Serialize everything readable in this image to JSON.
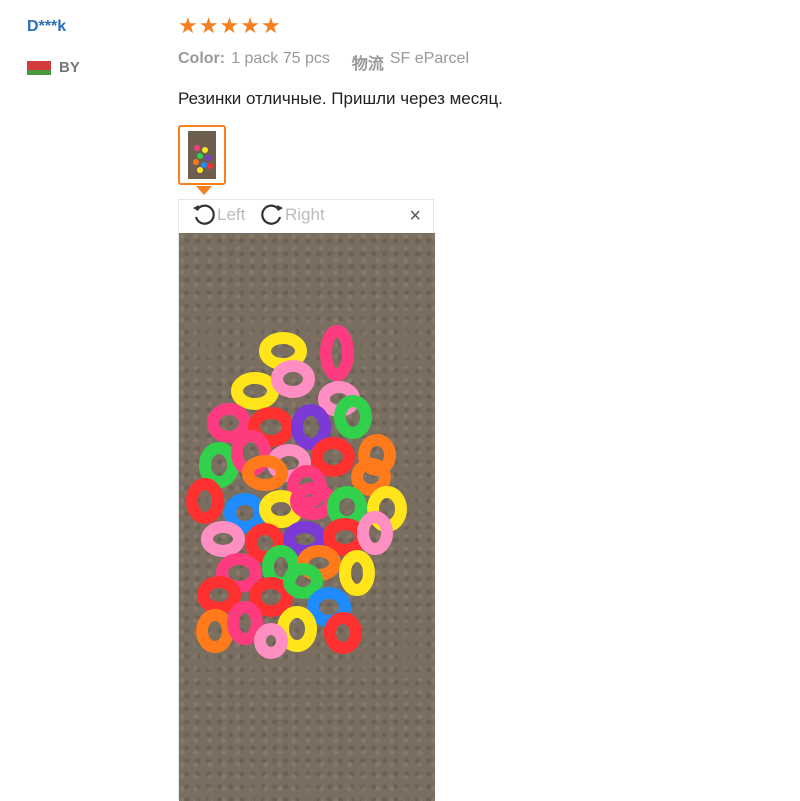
{
  "review": {
    "username": "D***k",
    "country_code": "BY",
    "star_count": 5,
    "star_glyph": "★",
    "color_key": "Color:",
    "color_value": "1 pack 75 pcs",
    "shipping_key": "物流",
    "shipping_value": "SF eParcel",
    "text": "Резинки отличные. Пришли через месяц."
  },
  "viewer": {
    "rotate_left_label": "Left",
    "rotate_right_label": "Right",
    "close_glyph": "×"
  },
  "colors": {
    "accent": "#f5801f",
    "username": "#2a6ebb",
    "rings": [
      "#ff3b7f",
      "#ffe51a",
      "#ff7a1a",
      "#31d14b",
      "#ff3030",
      "#7b3ad6",
      "#1e8cff",
      "#ff8fc2"
    ]
  }
}
